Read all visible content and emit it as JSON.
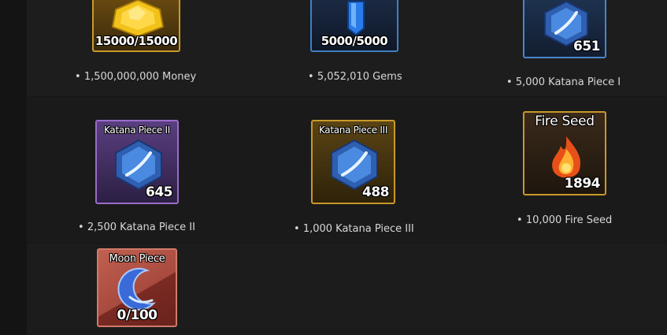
{
  "rewards": [
    {
      "tile_count": "15000/15000",
      "description": "1,500,000,000 Money",
      "icon": "gold-coin-icon",
      "frame_color": "#c89a2a"
    },
    {
      "tile_count": "5000/5000",
      "description": "5,052,010 Gems",
      "icon": "blue-gem-icon",
      "frame_color": "#3f7fc2"
    },
    {
      "tile_count": "651",
      "description": "5,000 Katana Piece I",
      "icon": "katana-piece-icon",
      "frame_color": "#4a85c8"
    },
    {
      "tile_name": "Katana Piece II",
      "tile_count": "645",
      "description": "2,500 Katana Piece II",
      "icon": "katana-piece-icon",
      "frame_color": "#9a6cc8"
    },
    {
      "tile_name": "Katana Piece III",
      "tile_count": "488",
      "description": "1,000 Katana Piece III",
      "icon": "katana-piece-icon",
      "frame_color": "#c8982a"
    },
    {
      "tile_name": "Fire Seed",
      "tile_count": "1894",
      "description": "10,000 Fire Seed",
      "icon": "fire-seed-icon",
      "frame_color": "#c8982a"
    },
    {
      "tile_name": "Moon Piece",
      "tile_count": "0/100",
      "icon": "moon-piece-icon",
      "frame_color": "#d07a6a"
    }
  ]
}
